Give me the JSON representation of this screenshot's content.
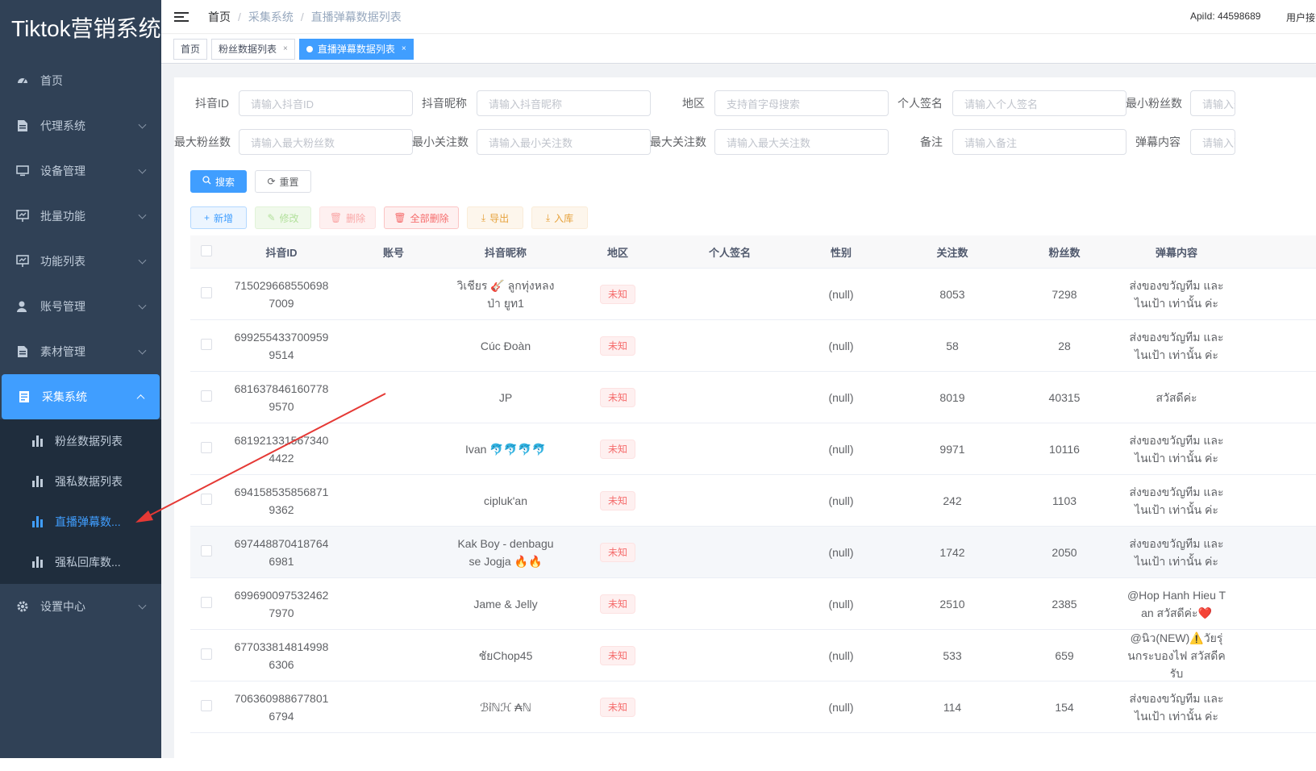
{
  "app": {
    "title": "Tiktok营销系统"
  },
  "sidebar": {
    "items": [
      {
        "label": "首页",
        "icon": "dashboard-icon"
      },
      {
        "label": "代理系统",
        "icon": "document-icon"
      },
      {
        "label": "设备管理",
        "icon": "monitor-icon"
      },
      {
        "label": "批量功能",
        "icon": "chart-board-icon"
      },
      {
        "label": "功能列表",
        "icon": "chart-board-icon"
      },
      {
        "label": "账号管理",
        "icon": "user-icon"
      },
      {
        "label": "素材管理",
        "icon": "document-icon"
      },
      {
        "label": "采集系统",
        "icon": "table-icon"
      },
      {
        "label": "设置中心",
        "icon": "gear-icon"
      }
    ],
    "sub_items": [
      {
        "label": "粉丝数据列表"
      },
      {
        "label": "强私数据列表"
      },
      {
        "label": "直播弹幕数..."
      },
      {
        "label": "强私回库数..."
      }
    ]
  },
  "header": {
    "breadcrumb": [
      "首页",
      "采集系统",
      "直播弹幕数据列表"
    ],
    "apiid": "ApiId: 44598689",
    "user": "用户接管"
  },
  "tags": [
    {
      "label": "首页"
    },
    {
      "label": "粉丝数据列表"
    },
    {
      "label": "直播弹幕数据列表"
    }
  ],
  "filters": {
    "douyin_id": {
      "label": "抖音ID",
      "placeholder": "请输入抖音ID"
    },
    "nickname": {
      "label": "抖音昵称",
      "placeholder": "请输入抖音昵称"
    },
    "region": {
      "label": "地区",
      "placeholder": "支持首字母搜索"
    },
    "signature": {
      "label": "个人签名",
      "placeholder": "请输入个人签名"
    },
    "min_fans": {
      "label": "最小粉丝数",
      "placeholder": "请输入最小粉丝数"
    },
    "max_fans": {
      "label": "最大粉丝数",
      "placeholder": "请输入最大粉丝数"
    },
    "min_follow": {
      "label": "最小关注数",
      "placeholder": "请输入最小关注数"
    },
    "max_follow": {
      "label": "最大关注数",
      "placeholder": "请输入最大关注数"
    },
    "remark": {
      "label": "备注",
      "placeholder": "请输入备注"
    },
    "danmu": {
      "label": "弹幕内容",
      "placeholder": "请输入弹幕内容"
    }
  },
  "buttons": {
    "search": "搜索",
    "reset": "重置",
    "add": "新增",
    "edit": "修改",
    "delete": "删除",
    "delete_all": "全部删除",
    "export": "导出",
    "import": "入库"
  },
  "table": {
    "headers": [
      "抖音ID",
      "账号",
      "抖音昵称",
      "地区",
      "个人签名",
      "性别",
      "关注数",
      "粉丝数",
      "弹幕内容"
    ],
    "rows": [
      {
        "id": "7150296685506987009",
        "account": "",
        "nickname": "วิเชียร 🎸 ลูกทุ่งหลงป่า ยูท1",
        "region": "未知",
        "signature": "",
        "gender": "(null)",
        "follow": "8053",
        "fans": "7298",
        "danmu": "ส่งของขวัญทีม และไนเป้า เท่านั้น ค่ะ"
      },
      {
        "id": "6992554337009599514",
        "account": "",
        "nickname": "Cúc Đoàn",
        "region": "未知",
        "signature": "",
        "gender": "(null)",
        "follow": "58",
        "fans": "28",
        "danmu": "ส่งของขวัญทีม และไนเป้า เท่านั้น ค่ะ"
      },
      {
        "id": "6816378461607789570",
        "account": "",
        "nickname": "JP",
        "region": "未知",
        "signature": "",
        "gender": "(null)",
        "follow": "8019",
        "fans": "40315",
        "danmu": "สวัสดีค่ะ"
      },
      {
        "id": "6819213315673404422",
        "account": "",
        "nickname": "Ivan 🐬🐬🐬🐬",
        "region": "未知",
        "signature": "",
        "gender": "(null)",
        "follow": "9971",
        "fans": "10116",
        "danmu": "ส่งของขวัญทีม และไนเป้า เท่านั้น ค่ะ"
      },
      {
        "id": "6941585358568719362",
        "account": "",
        "nickname": "cipluk'an",
        "region": "未知",
        "signature": "",
        "gender": "(null)",
        "follow": "242",
        "fans": "1103",
        "danmu": "ส่งของขวัญทีม และไนเป้า เท่านั้น ค่ะ"
      },
      {
        "id": "6974488704187646981",
        "account": "",
        "nickname": "Kak Boy - denbagu se Jogja 🔥🔥",
        "region": "未知",
        "signature": "",
        "gender": "(null)",
        "follow": "1742",
        "fans": "2050",
        "danmu": "ส่งของขวัญทีม และไนเป้า เท่านั้น ค่ะ"
      },
      {
        "id": "6996900975324627970",
        "account": "",
        "nickname": "Jame & Jelly",
        "region": "未知",
        "signature": "",
        "gender": "(null)",
        "follow": "2510",
        "fans": "2385",
        "danmu": "@Hop Hanh Hieu Tan สวัสดีค่ะ❤️"
      },
      {
        "id": "6770338148149986306",
        "account": "",
        "nickname": "ชัยChop45",
        "region": "未知",
        "signature": "",
        "gender": "(null)",
        "follow": "533",
        "fans": "659",
        "danmu": "@นิว(NEW)⚠️วัยรุ่นกระบองไฟ สวัสดีครับ"
      },
      {
        "id": "7063609886778016794",
        "account": "",
        "nickname": "ℬỉℕℋ ₳ℕ",
        "region": "未知",
        "signature": "",
        "gender": "(null)",
        "follow": "114",
        "fans": "154",
        "danmu": "ส่งของขวัญทีม และไนเป้า เท่านั้น ค่ะ"
      }
    ]
  },
  "colors": {
    "sidebar_bg": "#304156",
    "primary": "#409eff",
    "danger": "#f56c6c",
    "annotation_arrow": "#e53935"
  }
}
